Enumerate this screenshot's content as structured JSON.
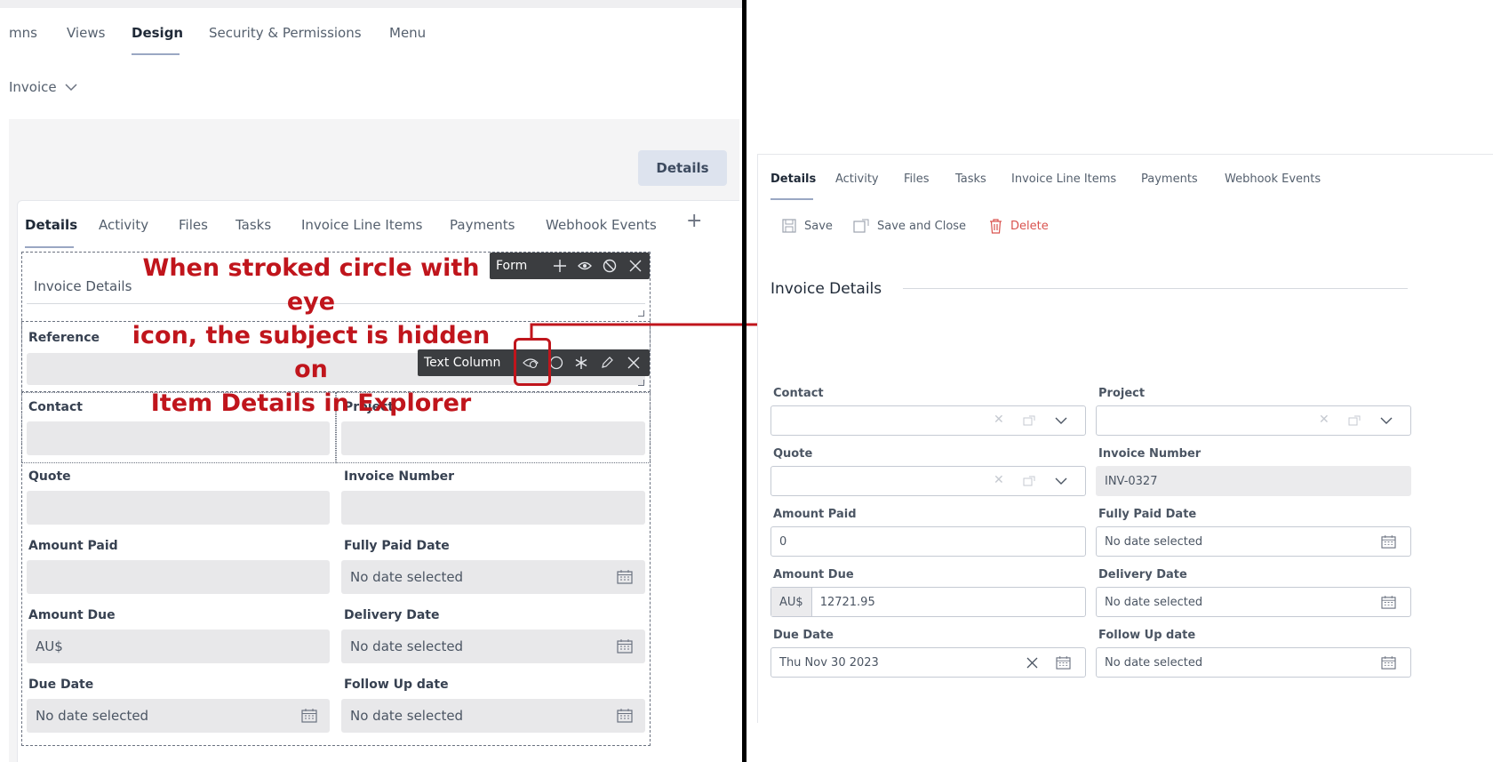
{
  "left": {
    "top_tabs": [
      "mns",
      "Views",
      "Design",
      "Security & Permissions",
      "Menu"
    ],
    "active_top_tab": "Design",
    "entity_selector": "Invoice",
    "details_button": "Details",
    "form_tabs": [
      "Details",
      "Activity",
      "Files",
      "Tasks",
      "Invoice Line Items",
      "Payments",
      "Webhook Events"
    ],
    "add_tab_glyph": "+",
    "form_toolbar_label": "Form",
    "text_column_toolbar_label": "Text Column",
    "section_title": "Invoice Details",
    "fields": {
      "reference": "Reference",
      "contact": "Contact",
      "project": "Project",
      "quote": "Quote",
      "invoice_number": "Invoice Number",
      "amount_paid": "Amount Paid",
      "fully_paid_date": "Fully Paid Date",
      "fully_paid_value": "No date selected",
      "amount_due": "Amount Due",
      "amount_due_value": "AU$",
      "delivery_date": "Delivery Date",
      "delivery_value": "No date selected",
      "due_date": "Due Date",
      "due_value": "No date selected",
      "follow_up_date": "Follow Up date",
      "follow_up_value": "No date selected"
    },
    "annotation_lines": [
      "When stroked circle with eye",
      "icon, the subject is hidden on",
      "Item Details in Explorer"
    ],
    "annotation_color": "#c0151c"
  },
  "right": {
    "tabs": [
      "Details",
      "Activity",
      "Files",
      "Tasks",
      "Invoice Line Items",
      "Payments",
      "Webhook Events"
    ],
    "actions": {
      "save": "Save",
      "save_close": "Save and Close",
      "delete": "Delete"
    },
    "section_title": "Invoice Details",
    "fields": {
      "contact": "Contact",
      "project": "Project",
      "quote": "Quote",
      "invoice_number": "Invoice Number",
      "invoice_number_value": "INV-0327",
      "amount_paid": "Amount Paid",
      "amount_paid_value": "0",
      "fully_paid_date": "Fully Paid Date",
      "fully_paid_value": "No date selected",
      "amount_due": "Amount Due",
      "currency": "AU$",
      "amount_due_value": "12721.95",
      "delivery_date": "Delivery Date",
      "delivery_value": "No date selected",
      "due_date": "Due Date",
      "due_value": "Thu Nov 30 2023",
      "follow_up_date": "Follow Up date",
      "follow_up_value": "No date selected"
    },
    "delete_color": "#d9534f"
  }
}
